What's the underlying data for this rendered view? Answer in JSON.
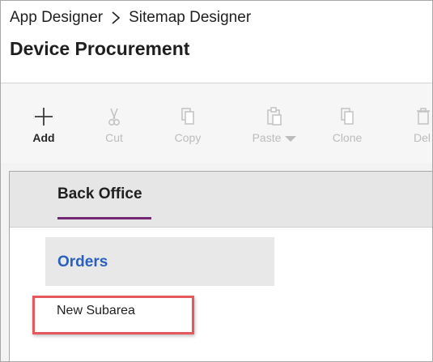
{
  "header": {
    "breadcrumb": {
      "root": "App Designer",
      "current": "Sitemap Designer"
    },
    "title": "Device Procurement"
  },
  "toolbar": {
    "add": "Add",
    "cut": "Cut",
    "copy": "Copy",
    "paste": "Paste",
    "clone": "Clone",
    "delete": "Del"
  },
  "canvas": {
    "area": {
      "label": "Back Office"
    },
    "group": {
      "label": "Orders"
    },
    "subarea": {
      "label": "New Subarea"
    }
  },
  "colors": {
    "accent_underline": "#742774",
    "group_text": "#2b5fbd",
    "highlight_box": "#e5585d"
  }
}
